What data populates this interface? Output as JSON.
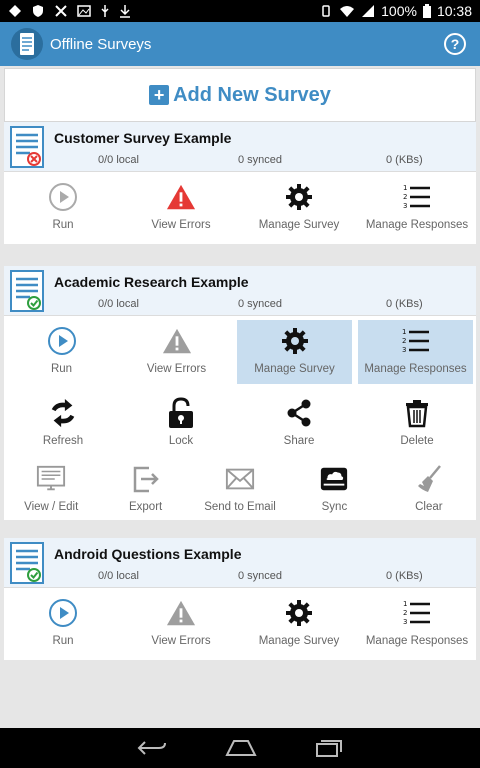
{
  "status": {
    "battery": "100%",
    "time": "10:38"
  },
  "app": {
    "title": "Offline Surveys",
    "help": "?"
  },
  "add": {
    "plus": "+",
    "label": "Add New Survey"
  },
  "surveys": [
    {
      "title": "Customer Survey Example",
      "local": "0/0 local",
      "synced": "0 synced",
      "kbs": "0 (KBs)",
      "actions": {
        "run": "Run",
        "errors": "View Errors",
        "manage": "Manage Survey",
        "responses": "Manage Responses"
      }
    },
    {
      "title": "Academic Research Example",
      "local": "0/0 local",
      "synced": "0 synced",
      "kbs": "0 (KBs)",
      "actions": {
        "run": "Run",
        "errors": "View Errors",
        "manage": "Manage Survey",
        "responses": "Manage Responses"
      },
      "extra_row1": {
        "refresh": "Refresh",
        "lock": "Lock",
        "share": "Share",
        "delete": "Delete"
      },
      "extra_row2": {
        "view_edit": "View / Edit",
        "export": "Export",
        "email": "Send to Email",
        "sync": "Sync",
        "clear": "Clear"
      }
    },
    {
      "title": "Android Questions Example",
      "local": "0/0 local",
      "synced": "0 synced",
      "kbs": "0 (KBs)",
      "actions": {
        "run": "Run",
        "errors": "View Errors",
        "manage": "Manage Survey",
        "responses": "Manage Responses"
      }
    }
  ],
  "colors": {
    "primary": "#3f8cc4",
    "error": "#e53935",
    "selected": "#c8ddef",
    "check": "#2e9e3e"
  }
}
